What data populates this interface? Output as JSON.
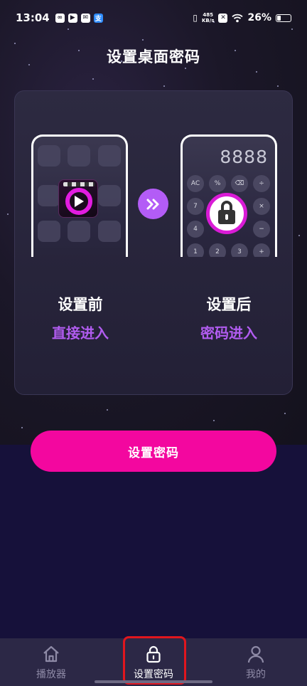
{
  "status_bar": {
    "time": "13:04",
    "net_speed_value": "485",
    "net_speed_unit": "KB/s",
    "battery": "26%"
  },
  "page": {
    "title": "设置桌面密码"
  },
  "compare": {
    "before": {
      "label": "设置前",
      "sub": "直接进入"
    },
    "after": {
      "label": "设置后",
      "sub": "密码进入"
    },
    "calculator_display": "8888",
    "calculator_keys": [
      "AC",
      "%",
      "⌫",
      "÷",
      "7",
      "×",
      "4",
      "−",
      "1",
      "2",
      "3",
      "+"
    ]
  },
  "cta": {
    "label": "设置密码"
  },
  "bottom_nav": {
    "items": [
      {
        "label": "播放器",
        "icon": "home-icon"
      },
      {
        "label": "设置密码",
        "icon": "lock-icon"
      },
      {
        "label": "我的",
        "icon": "person-icon"
      }
    ],
    "active_index": 1
  },
  "colors": {
    "accent_pink": "#f3079f",
    "accent_purple": "#b15cf0",
    "highlight_red": "#e0161e"
  }
}
